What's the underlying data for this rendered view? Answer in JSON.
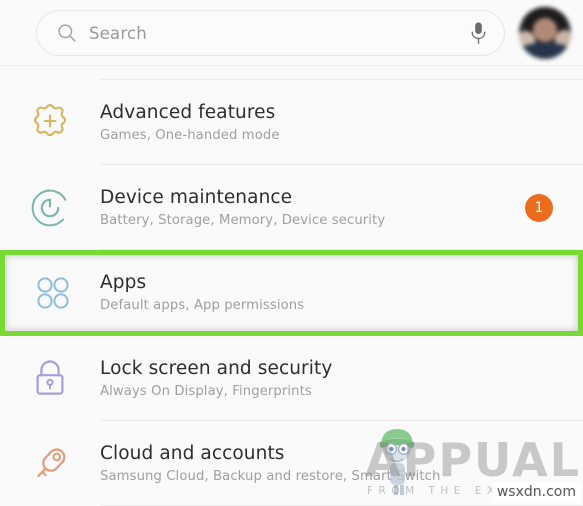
{
  "header": {
    "search": {
      "placeholder": "Search",
      "value": "",
      "search_icon": "search-icon",
      "mic_icon": "microphone-icon"
    },
    "avatar": {
      "name": "user-avatar"
    }
  },
  "settings": {
    "items": [
      {
        "id": "advanced-features",
        "title": "Advanced features",
        "subtitle": "Games, One-handed mode",
        "icon": "gear-plus-icon",
        "icon_color": "#d8b45e",
        "badge": null,
        "highlighted": false
      },
      {
        "id": "device-maintenance",
        "title": "Device maintenance",
        "subtitle": "Battery, Storage, Memory, Device security",
        "icon": "refresh-circle-icon",
        "icon_color": "#7cb7ad",
        "badge": "1",
        "badge_color": "#ec6c1e",
        "highlighted": false
      },
      {
        "id": "apps",
        "title": "Apps",
        "subtitle": "Default apps, App permissions",
        "icon": "four-circles-grid-icon",
        "icon_color": "#8fbedd",
        "badge": null,
        "highlighted": true,
        "highlight_color": "#78d935"
      },
      {
        "id": "lock-screen-and-security",
        "title": "Lock screen and security",
        "subtitle": "Always On Display, Fingerprints",
        "icon": "padlock-icon",
        "icon_color": "#a79ed8",
        "badge": null,
        "highlighted": false
      },
      {
        "id": "cloud-and-accounts",
        "title": "Cloud and accounts",
        "subtitle": "Samsung Cloud, Backup and restore, Smart Switch",
        "icon": "key-icon",
        "icon_color": "#e39a78",
        "badge": null,
        "highlighted": false
      }
    ]
  },
  "watermark": {
    "brand": "APPUALS",
    "tagline": "FROM THE EXPERTS",
    "domain": "wsxdn.com"
  }
}
